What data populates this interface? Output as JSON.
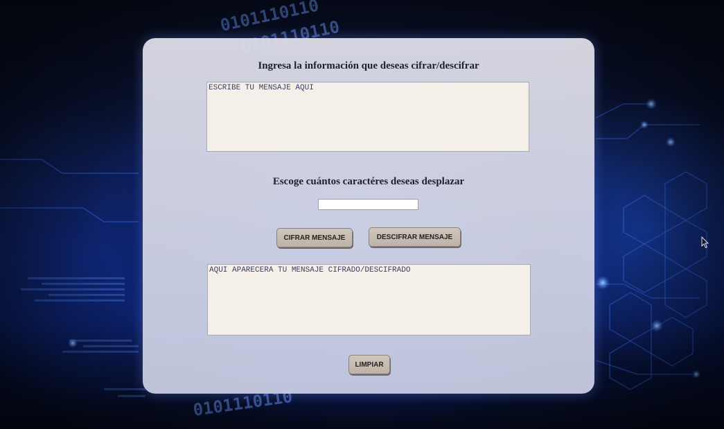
{
  "form": {
    "input_heading": "Ingresa la información que deseas cifrar/descifrar",
    "input_placeholder": "ESCRIBE TU MENSAJE AQUI",
    "shift_heading": "Escoge cuántos caractéres deseas desplazar",
    "shift_value": "",
    "encrypt_button": "CIFRAR MENSAJE",
    "decrypt_button": "DESCIFRAR MENSAJE",
    "output_placeholder": "AQUI APARECERA TU MENSAJE CIFRADO/DESCIFRADO",
    "clear_button": "LIMPIAR"
  },
  "background": {
    "binary_text": "0101110110",
    "colors": {
      "deep": "#050a18",
      "glow": "#3c6eff"
    }
  },
  "colors": {
    "panel": "#dedee8",
    "textarea_bg": "#f4efe8",
    "button_bg": "#c8beb3",
    "heading_text": "#1d2030"
  },
  "icons": {
    "cursor": "mouse-pointer-icon"
  }
}
